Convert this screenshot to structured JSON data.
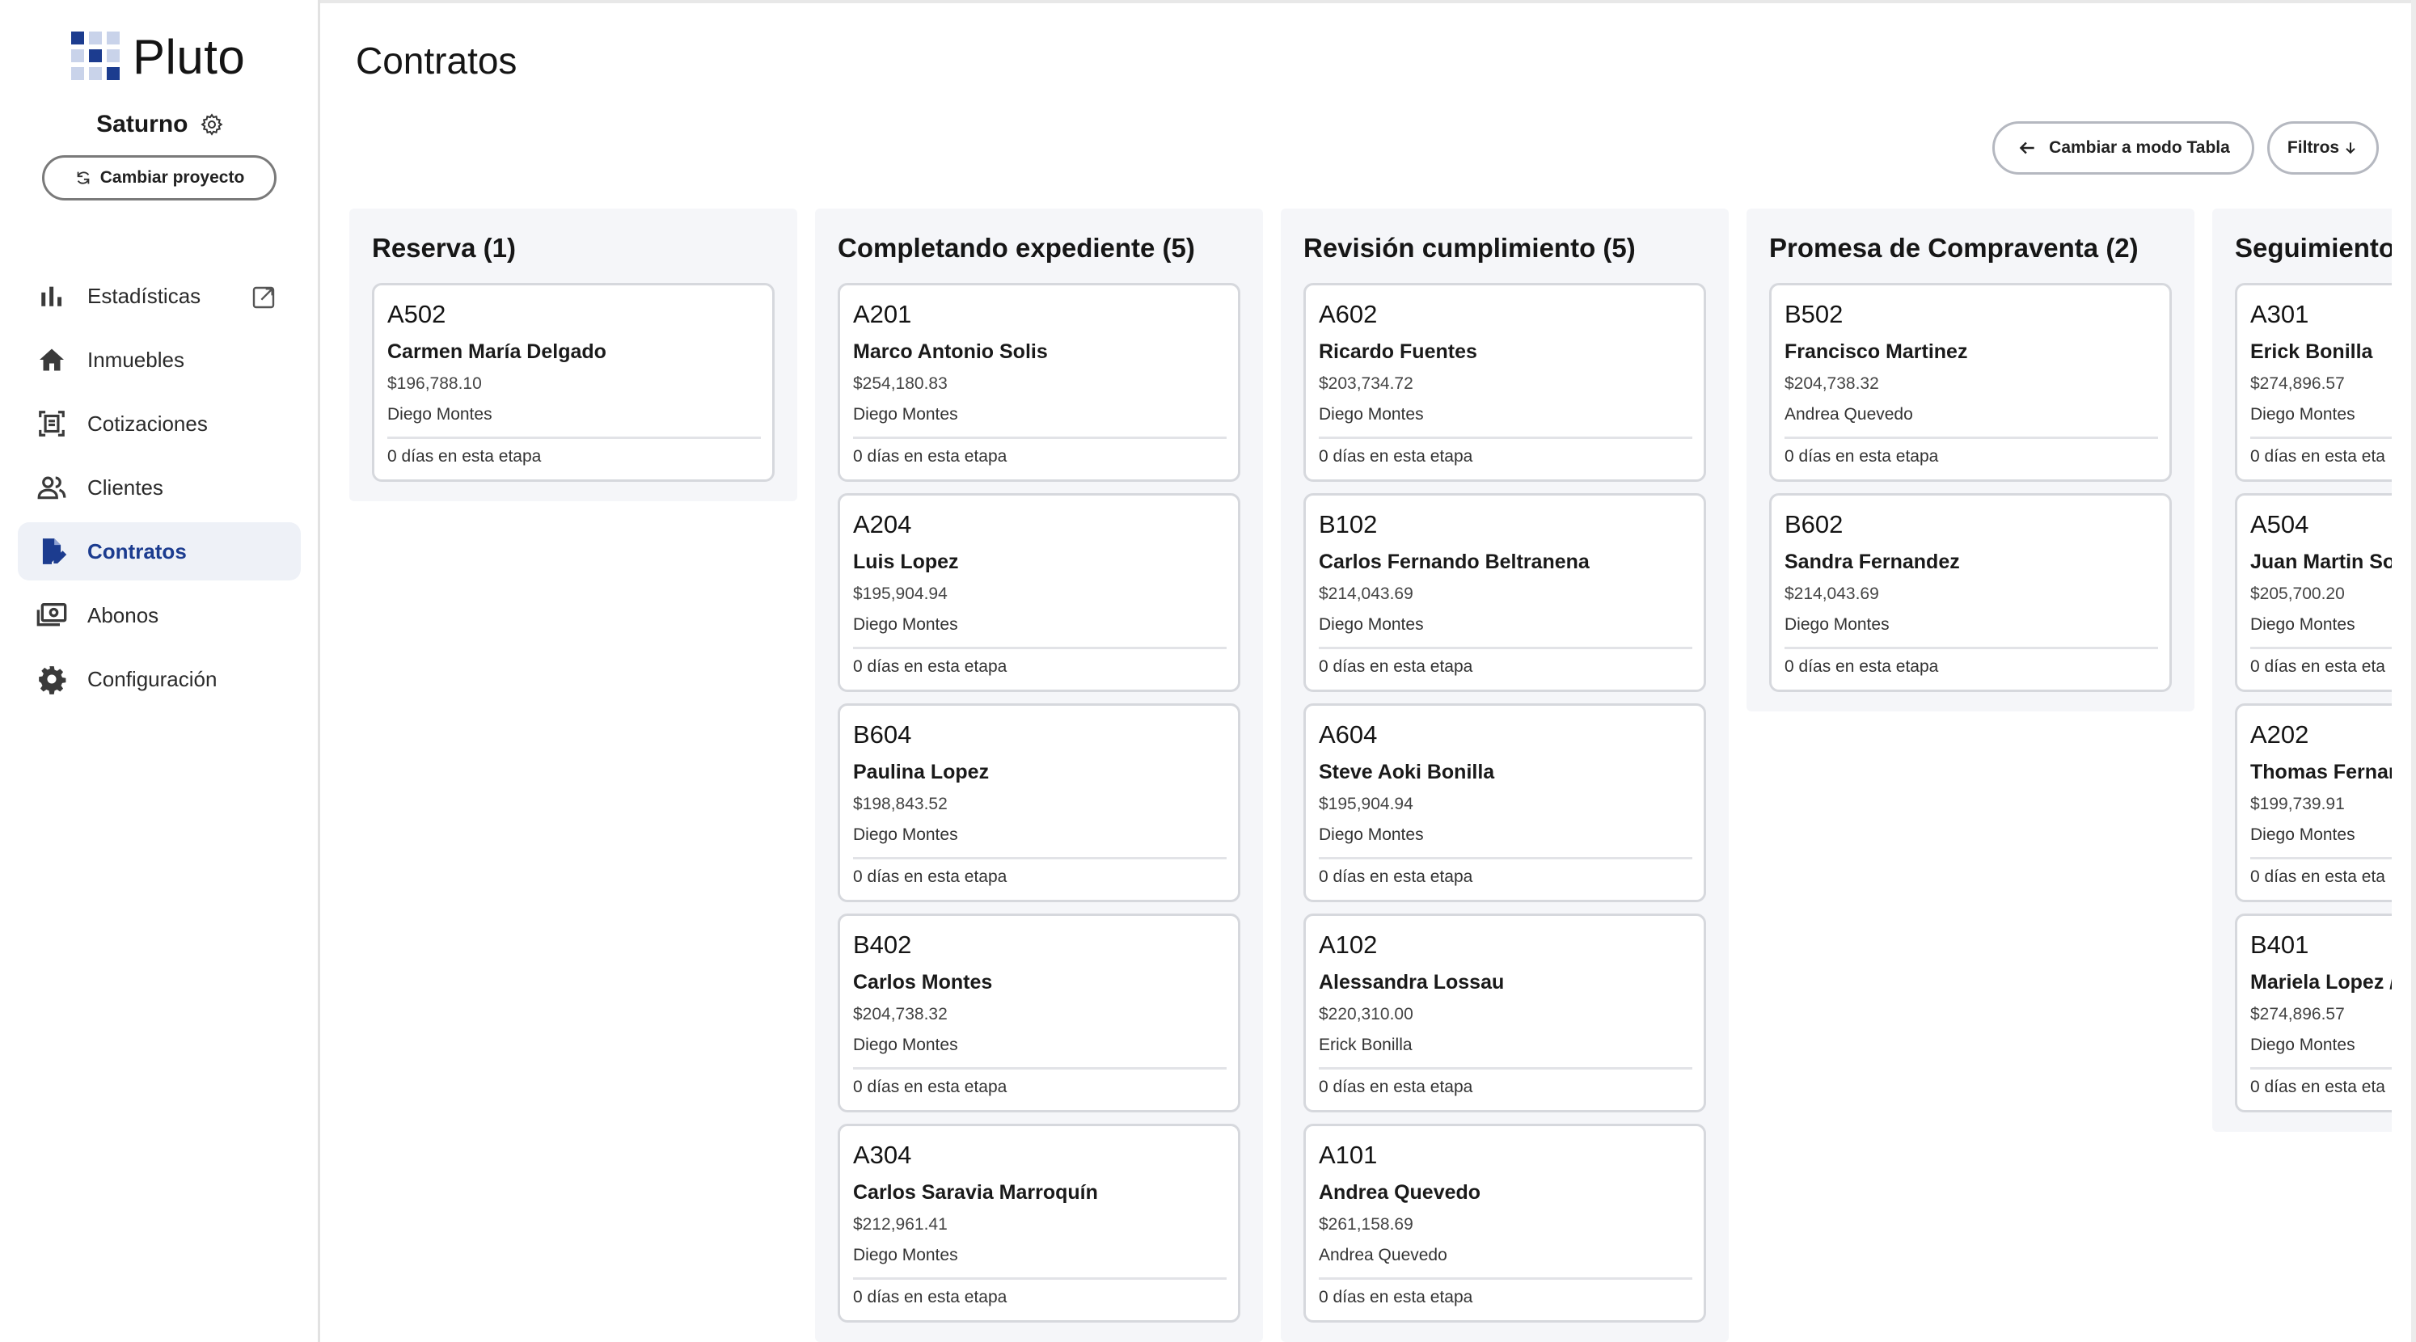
{
  "app": {
    "name": "Pluto",
    "project_name": "Saturno",
    "change_project_label": "Cambiar proyecto",
    "accent": "#1c3c8f"
  },
  "sidebar": {
    "items": [
      {
        "label": "Estadísticas",
        "icon": "bar-chart-icon"
      },
      {
        "label": "Inmuebles",
        "icon": "home-icon"
      },
      {
        "label": "Cotizaciones",
        "icon": "document-scan-icon"
      },
      {
        "label": "Clientes",
        "icon": "people-icon"
      },
      {
        "label": "Contratos",
        "icon": "contract-edit-icon",
        "active": true
      },
      {
        "label": "Abonos",
        "icon": "payments-icon"
      },
      {
        "label": "Configuración",
        "icon": "gear-icon"
      }
    ]
  },
  "header": {
    "title": "Contratos",
    "table_mode_label": "Cambiar a modo Tabla",
    "filters_label": "Filtros"
  },
  "board": {
    "columns": [
      {
        "title": "Reserva (1)",
        "cards": [
          {
            "unit": "A502",
            "client": "Carmen María Delgado",
            "price": "$196,788.10",
            "agent": "Diego Montes",
            "days": "0 días en esta etapa"
          }
        ]
      },
      {
        "title": "Completando expediente (5)",
        "cards": [
          {
            "unit": "A201",
            "client": "Marco Antonio Solis",
            "price": "$254,180.83",
            "agent": "Diego Montes",
            "days": "0 días en esta etapa"
          },
          {
            "unit": "A204",
            "client": "Luis Lopez",
            "price": "$195,904.94",
            "agent": "Diego Montes",
            "days": "0 días en esta etapa"
          },
          {
            "unit": "B604",
            "client": "Paulina Lopez",
            "price": "$198,843.52",
            "agent": "Diego Montes",
            "days": "0 días en esta etapa"
          },
          {
            "unit": "B402",
            "client": "Carlos Montes",
            "price": "$204,738.32",
            "agent": "Diego Montes",
            "days": "0 días en esta etapa"
          },
          {
            "unit": "A304",
            "client": "Carlos Saravia Marroquín",
            "price": "$212,961.41",
            "agent": "Diego Montes",
            "days": "0 días en esta etapa"
          }
        ]
      },
      {
        "title": "Revisión cumplimiento (5)",
        "cards": [
          {
            "unit": "A602",
            "client": "Ricardo Fuentes",
            "price": "$203,734.72",
            "agent": "Diego Montes",
            "days": "0 días en esta etapa"
          },
          {
            "unit": "B102",
            "client": "Carlos Fernando Beltranena",
            "price": "$214,043.69",
            "agent": "Diego Montes",
            "days": "0 días en esta etapa"
          },
          {
            "unit": "A604",
            "client": "Steve Aoki Bonilla",
            "price": "$195,904.94",
            "agent": "Diego Montes",
            "days": "0 días en esta etapa"
          },
          {
            "unit": "A102",
            "client": "Alessandra Lossau",
            "price": "$220,310.00",
            "agent": "Erick Bonilla",
            "days": "0 días en esta etapa"
          },
          {
            "unit": "A101",
            "client": "Andrea Quevedo",
            "price": "$261,158.69",
            "agent": "Andrea Quevedo",
            "days": "0 días en esta etapa"
          }
        ]
      },
      {
        "title": "Promesa de Compraventa (2)",
        "cards": [
          {
            "unit": "B502",
            "client": "Francisco Martinez",
            "price": "$204,738.32",
            "agent": "Andrea Quevedo",
            "days": "0 días en esta etapa"
          },
          {
            "unit": "B602",
            "client": "Sandra Fernandez",
            "price": "$214,043.69",
            "agent": "Diego Montes",
            "days": "0 días en esta etapa"
          }
        ]
      },
      {
        "title": "Seguimiento",
        "cards": [
          {
            "unit": "A301",
            "client": "Erick Bonilla",
            "price": "$274,896.57",
            "agent": "Diego Montes",
            "days": "0 días en esta eta"
          },
          {
            "unit": "A504",
            "client": "Juan Martin So",
            "price": "$205,700.20",
            "agent": "Diego Montes",
            "days": "0 días en esta eta"
          },
          {
            "unit": "A202",
            "client": "Thomas Fernar",
            "price": "$199,739.91",
            "agent": "Diego Montes",
            "days": "0 días en esta eta"
          },
          {
            "unit": "B401",
            "client": "Mariela Lopez /",
            "price": "$274,896.57",
            "agent": "Diego Montes",
            "days": "0 días en esta eta"
          }
        ]
      }
    ]
  }
}
